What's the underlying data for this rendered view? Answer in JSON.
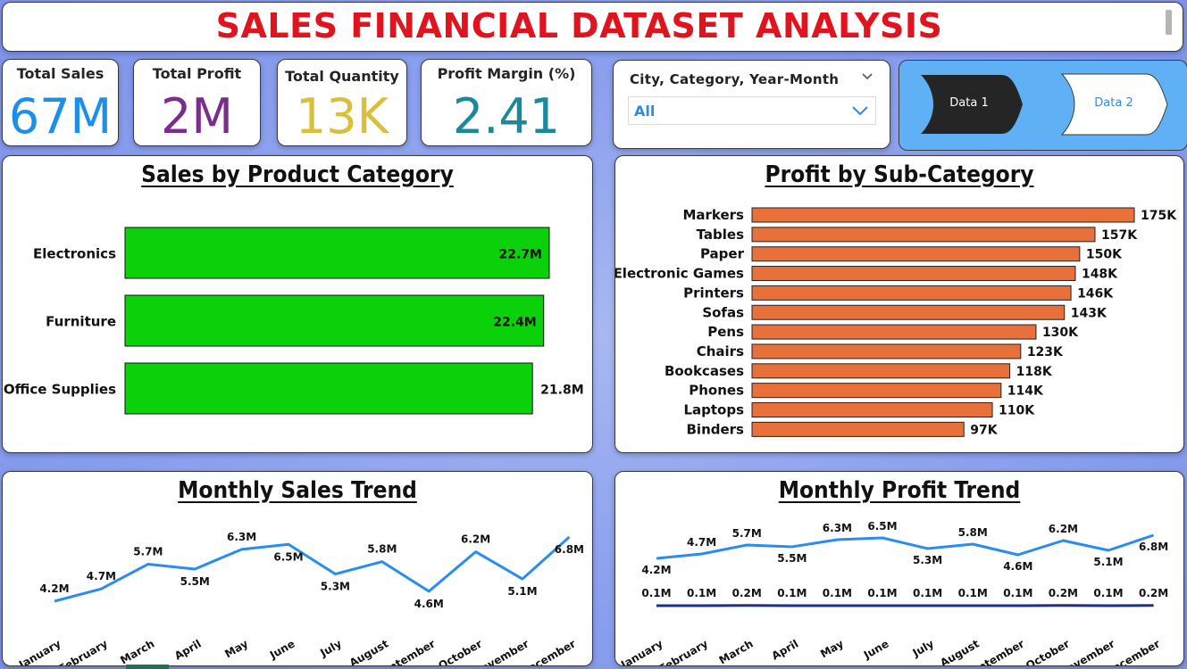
{
  "header": {
    "title": "SALES FINANCIAL DATASET ANALYSIS"
  },
  "kpis": [
    {
      "label": "Total Sales",
      "value": "67M",
      "color": "#1e8fe8"
    },
    {
      "label": "Total Profit",
      "value": "2M",
      "color": "#7b2d8e"
    },
    {
      "label": "Total Quantity",
      "value": "13K",
      "color": "#d9bf3a"
    },
    {
      "label": "Profit Margin (%)",
      "value": "2.41",
      "color": "#1a8a9a"
    }
  ],
  "slicer": {
    "label": "City, Category, Year-Month",
    "value": "All"
  },
  "nav": {
    "data1": "Data 1",
    "data2": "Data 2"
  },
  "colors": {
    "accent_red": "#e0141e",
    "bar_green": "#0ad10a",
    "bar_orange": "#e8703a",
    "line_blue": "#2a8cee",
    "line_navy": "#1c2f8c"
  },
  "charts": [
    {
      "type": "bar",
      "title": "Sales by Product Category",
      "categories": [
        "Electronics",
        "Furniture",
        "Office Supplies"
      ],
      "values": [
        22.7,
        22.4,
        21.8
      ],
      "labels": [
        "22.7M",
        "22.4M",
        "21.8M"
      ]
    },
    {
      "type": "bar",
      "title": "Profit by Sub-Category",
      "categories": [
        "Markers",
        "Tables",
        "Paper",
        "Electronic Games",
        "Printers",
        "Sofas",
        "Pens",
        "Chairs",
        "Bookcases",
        "Phones",
        "Laptops",
        "Binders"
      ],
      "values": [
        175,
        157,
        150,
        148,
        146,
        143,
        130,
        123,
        118,
        114,
        110,
        97
      ],
      "labels": [
        "175K",
        "157K",
        "150K",
        "148K",
        "146K",
        "143K",
        "130K",
        "123K",
        "118K",
        "114K",
        "110K",
        "97K"
      ]
    },
    {
      "type": "line",
      "title": "Monthly Sales Trend",
      "categories": [
        "January",
        "February",
        "March",
        "April",
        "May",
        "June",
        "July",
        "August",
        "September",
        "October",
        "November",
        "December"
      ],
      "values": [
        4.2,
        4.7,
        5.7,
        5.5,
        6.3,
        6.5,
        5.3,
        5.8,
        4.6,
        6.2,
        5.1,
        6.8
      ],
      "labels": [
        "4.2M",
        "4.7M",
        "5.7M",
        "5.5M",
        "6.3M",
        "6.5M",
        "5.3M",
        "5.8M",
        "4.6M",
        "6.2M",
        "5.1M",
        "6.8M"
      ]
    },
    {
      "type": "line",
      "title": "Monthly Profit Trend",
      "categories": [
        "January",
        "February",
        "March",
        "April",
        "May",
        "June",
        "July",
        "August",
        "September",
        "October",
        "November",
        "December"
      ],
      "series": [
        {
          "values": [
            4.2,
            4.7,
            5.7,
            5.5,
            6.3,
            6.5,
            5.3,
            5.8,
            4.6,
            6.2,
            5.1,
            6.8
          ],
          "labels": [
            "4.2M",
            "4.7M",
            "5.7M",
            "5.5M",
            "6.3M",
            "6.5M",
            "5.3M",
            "5.8M",
            "4.6M",
            "6.2M",
            "5.1M",
            "6.8M"
          ]
        },
        {
          "values": [
            0.1,
            0.1,
            0.2,
            0.1,
            0.1,
            0.1,
            0.1,
            0.1,
            0.1,
            0.2,
            0.1,
            0.2
          ],
          "labels": [
            "0.1M",
            "0.1M",
            "0.2M",
            "0.1M",
            "0.1M",
            "0.1M",
            "0.1M",
            "0.1M",
            "0.1M",
            "0.2M",
            "0.1M",
            "0.2M"
          ]
        }
      ]
    }
  ]
}
